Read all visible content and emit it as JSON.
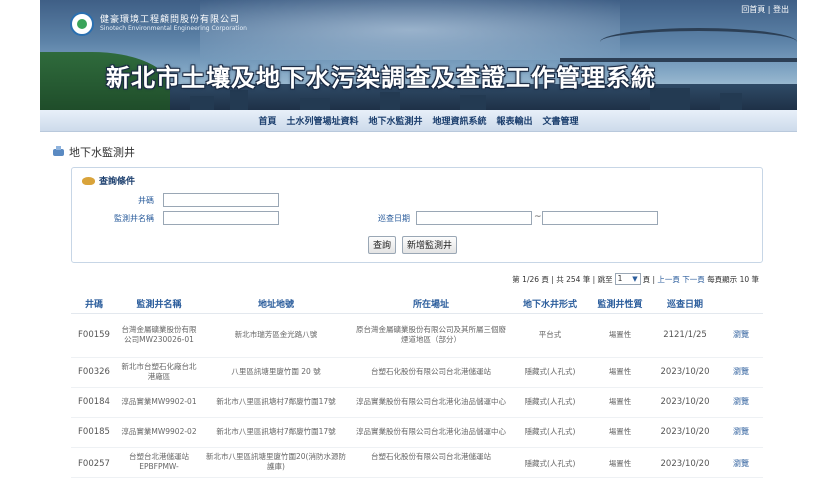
{
  "header": {
    "company": "健豪環境工程顧問股份有限公司",
    "company_en": "Sinotech Environmental Engineering Corporation",
    "system_title": "新北市土壤及地下水污染調查及查證工作管理系統",
    "top_links": "回首頁 | 登出"
  },
  "nav": {
    "items": [
      "首頁",
      "土水列管場址資料",
      "地下水監測井",
      "地理資訊系統",
      "報表輸出",
      "文書管理"
    ]
  },
  "page": {
    "title": "地下水監測井"
  },
  "search": {
    "header": "查詢條件",
    "well_id_label": "井碼",
    "well_id_value": "",
    "well_name_label": "監測井名稱",
    "well_name_value": "",
    "inspect_date_label": "巡查日期",
    "date_from": "",
    "date_to": "",
    "tilde": "~",
    "query_button": "查詢",
    "add_button": "新增監測井"
  },
  "pager": {
    "page_info": "第 1/26 頁 | 共 254 筆 | 跳至",
    "page_select": "1",
    "page_suffix": "頁 |",
    "prev": "上一頁",
    "next": "下一頁",
    "per_page": "每頁顯示 10 筆"
  },
  "table": {
    "columns": [
      "井碼",
      "監測井名稱",
      "地址地號",
      "所在場址",
      "地下水井形式",
      "監測井性質",
      "巡查日期",
      ""
    ],
    "rows": [
      {
        "code": "F00159",
        "name": "台灣金屬礦業股份有限公司MW230026-01",
        "address": "新北市瑞芳區金光路八號",
        "site": "原台灣金屬礦業股份有限公司及其所屬三個廢煙道地區（部分）",
        "type": "平台式",
        "nature": "場置性",
        "date": "2121/1/25",
        "action": "瀏覽"
      },
      {
        "code": "F00326",
        "name": "新北市台塑石化廠台北港廠區",
        "address": "八里區訊塘里廈竹圍 20 號",
        "site": "台塑石化股份有限公司台北港儲運站",
        "type": "隱藏式(人孔式)",
        "nature": "場置性",
        "date": "2023/10/20",
        "action": "瀏覽"
      },
      {
        "code": "F00184",
        "name": "淳品實業MW9902-01",
        "address": "新北市八里區訊塘村7鄰廈竹圍17號",
        "site": "淳品實業股份有限公司台北港化油品儲運中心",
        "type": "隱藏式(人孔式)",
        "nature": "場置性",
        "date": "2023/10/20",
        "action": "瀏覽"
      },
      {
        "code": "F00185",
        "name": "淳品實業MW9902-02",
        "address": "新北市八里區訊塘村7鄰廈竹圍17號",
        "site": "淳品實業股份有限公司台北港化油品儲運中心",
        "type": "隱藏式(人孔式)",
        "nature": "場置性",
        "date": "2023/10/20",
        "action": "瀏覽"
      },
      {
        "code": "F00257",
        "name": "台塑台北港儲運站EPBFPMW-",
        "address": "新北市八里區訊塘里廈竹圍20(消防水源防護庫)",
        "site": "台塑石化股份有限公司台北港儲運站",
        "type": "隱藏式(人孔式)",
        "nature": "場置性",
        "date": "2023/10/20",
        "action": "瀏覽"
      }
    ]
  }
}
